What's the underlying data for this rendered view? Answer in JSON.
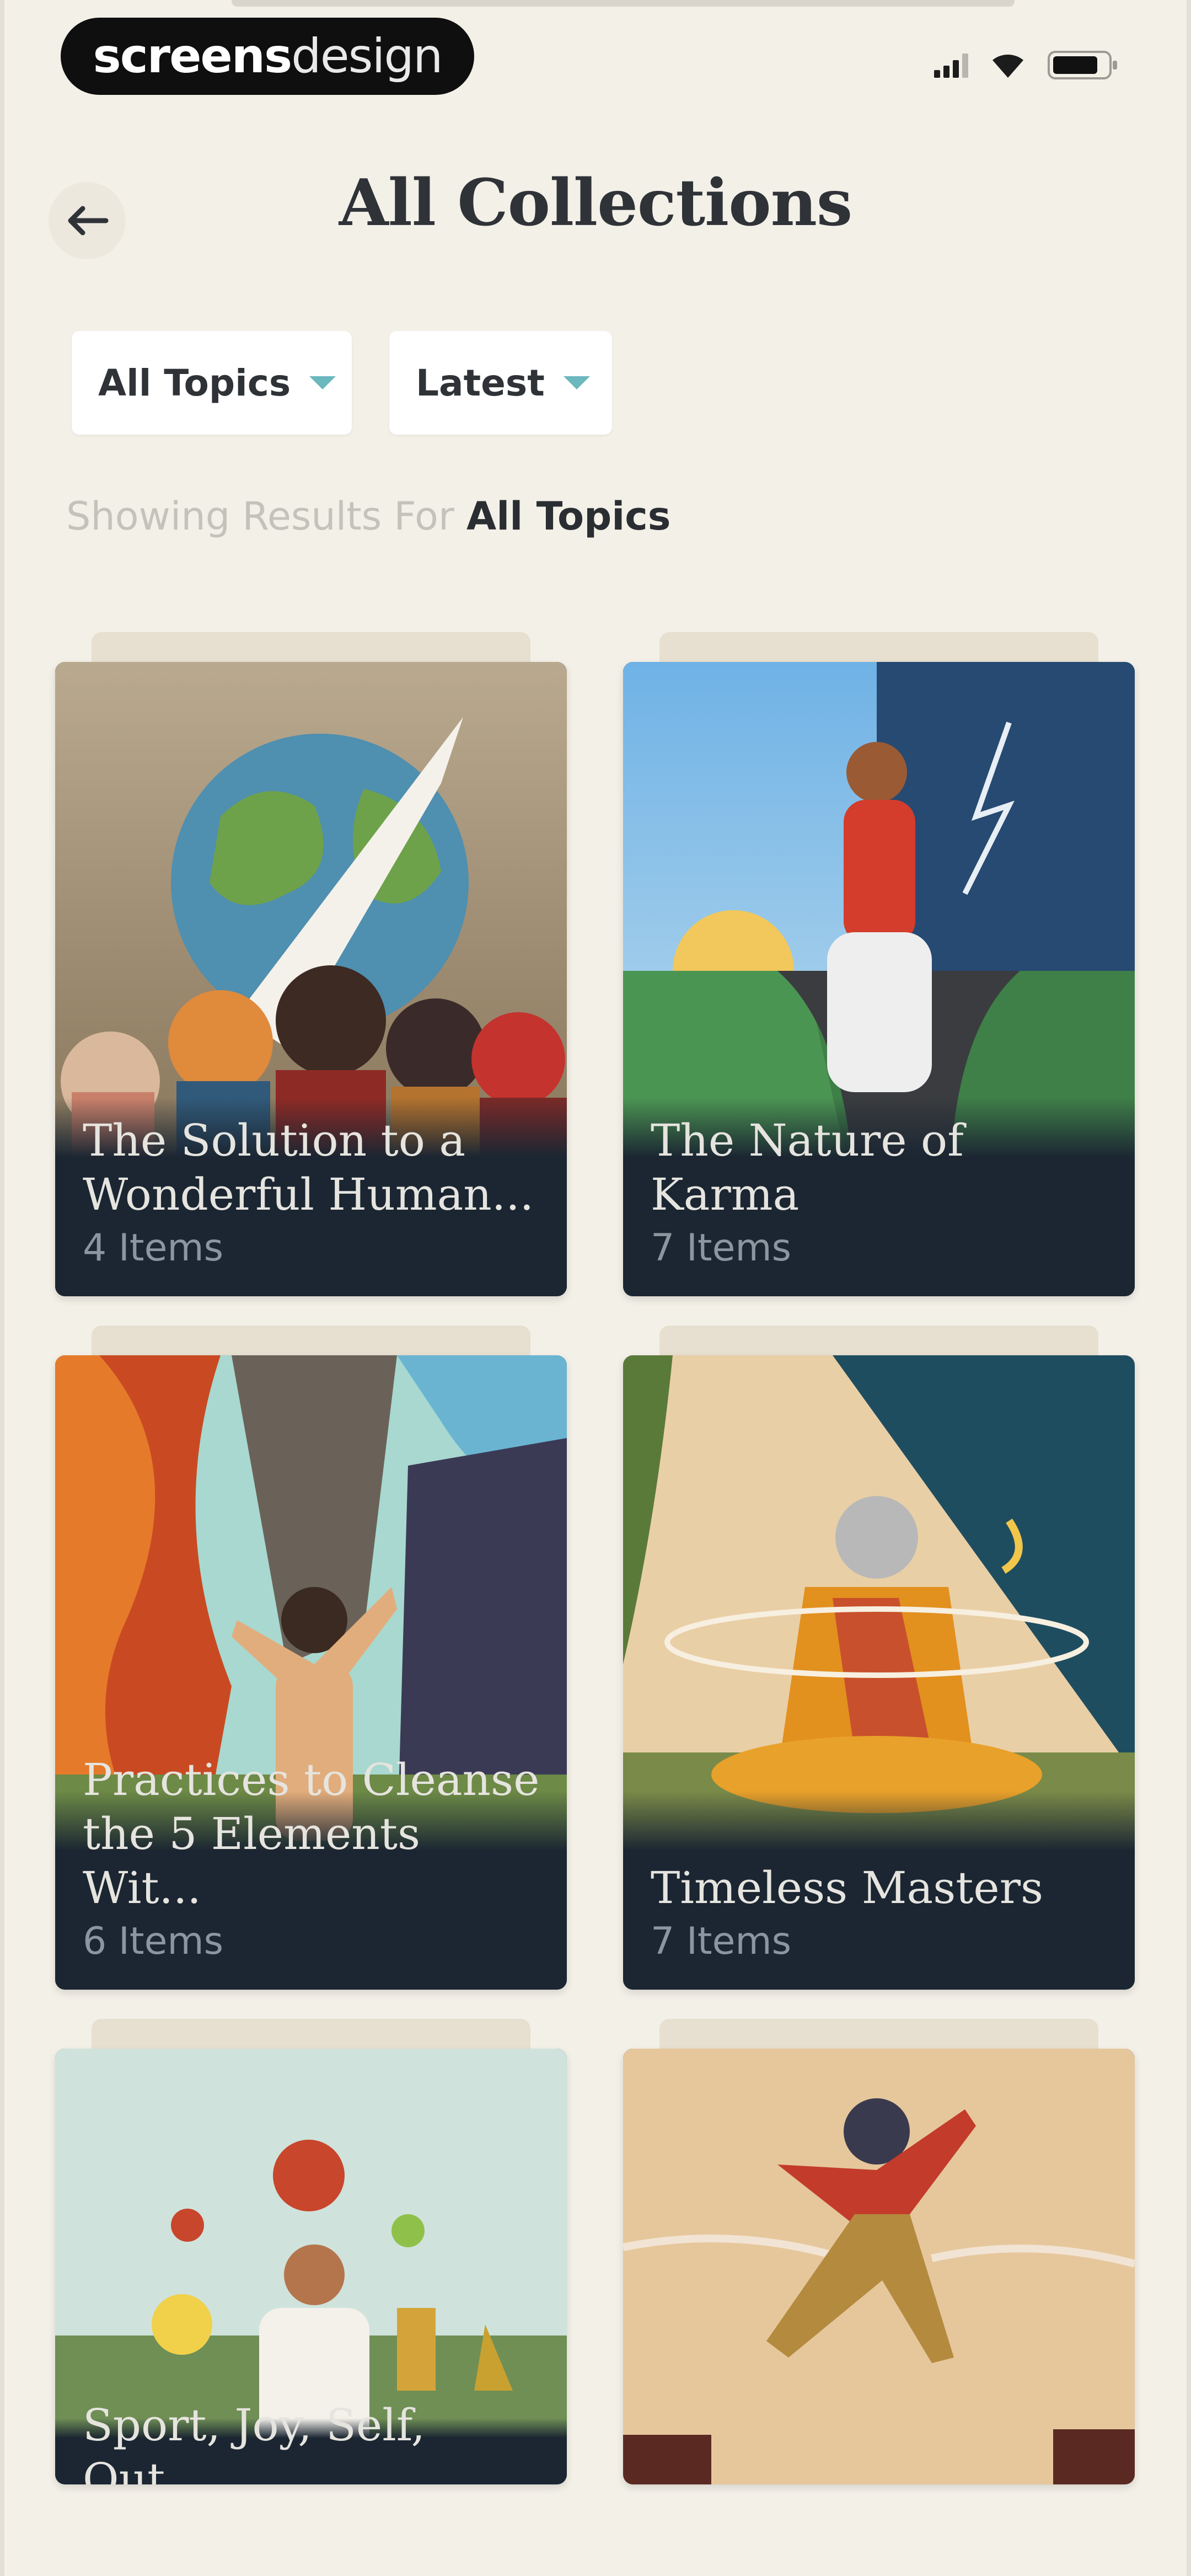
{
  "status_bar": {
    "brand_bold": "screens",
    "brand_light": "design"
  },
  "header": {
    "title": "All Collections"
  },
  "filters": {
    "topic_label": "All Topics",
    "sort_label": "Latest"
  },
  "results": {
    "prefix": "Showing Results For",
    "topic": "All Topics"
  },
  "collections": [
    {
      "title": "The Solution to a Wonderful Human...",
      "count": "4 Items"
    },
    {
      "title": "The Nature of Karma",
      "count": "7 Items"
    },
    {
      "title": "Practices to Cleanse the 5 Elements Wit...",
      "count": "6 Items"
    },
    {
      "title": "Timeless Masters",
      "count": "7 Items"
    },
    {
      "title": "Sport, Joy, Self, Out...",
      "count": ""
    },
    {
      "title": "",
      "count": ""
    }
  ],
  "colors": {
    "background": "#f3f0e8",
    "card_footer": "#1b2632",
    "caret": "#6bb8be",
    "title_text": "#2f3338"
  }
}
